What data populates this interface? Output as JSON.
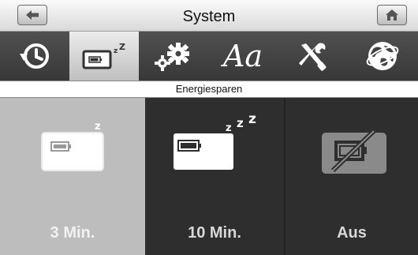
{
  "header": {
    "title": "System",
    "back_icon": "arrow-left-icon",
    "home_icon": "home-icon"
  },
  "tabs": [
    {
      "icon": "clock-history-icon",
      "active": false
    },
    {
      "icon": "sleep-battery-icon",
      "active": true
    },
    {
      "icon": "gears-icon",
      "active": false
    },
    {
      "icon": "font-aa-icon",
      "text": "Aa",
      "active": false
    },
    {
      "icon": "tools-icon",
      "active": false
    },
    {
      "icon": "globe-icon",
      "active": false
    }
  ],
  "section": {
    "title": "Energiesparen"
  },
  "options": [
    {
      "label": "3 Min.",
      "selected": true
    },
    {
      "label": "10 Min.",
      "selected": false
    },
    {
      "label": "Aus",
      "selected": false
    }
  ],
  "colors": {
    "header_bg": "#e6e6e6",
    "bar_bg": "#444444",
    "active_tab_bg": "#d6d6d6",
    "selected_option_bg": "#bdbdbd",
    "option_bg": "#2e2e2e"
  }
}
